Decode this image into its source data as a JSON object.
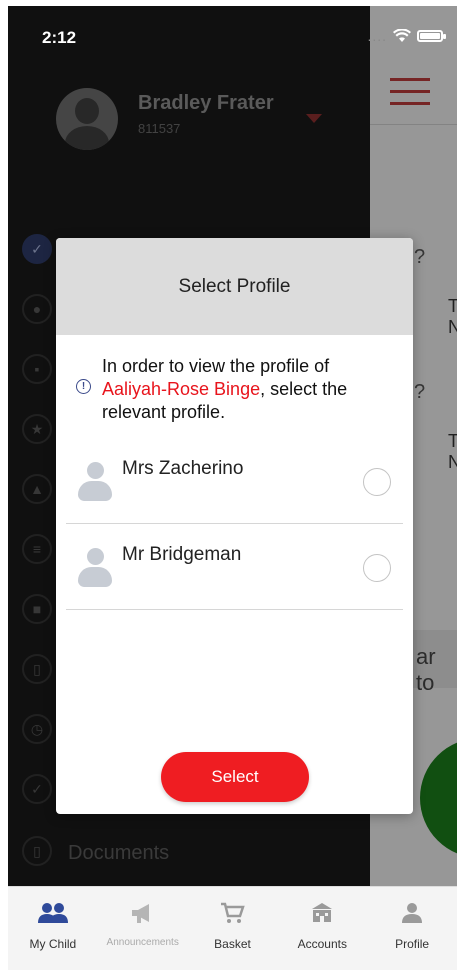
{
  "status_bar": {
    "time": "2:12"
  },
  "drawer": {
    "user_name": "Bradley Frater",
    "user_id": "811537",
    "documents_label": "Documents"
  },
  "background_page": {
    "banner_text": "ar to"
  },
  "modal": {
    "title": "Select Profile",
    "intro_prefix": "In order to view the profile of",
    "child_name": "Aaliyah-Rose Binge",
    "intro_suffix": ", select the relevant profile.",
    "profiles": [
      {
        "name": "Mrs Zacherino"
      },
      {
        "name": "Mr Bridgeman"
      }
    ],
    "select_label": "Select"
  },
  "tabbar": {
    "tabs": [
      {
        "label": "My Child",
        "icon": "people-icon"
      },
      {
        "label": "Announcements",
        "icon": "megaphone-icon"
      },
      {
        "label": "Basket",
        "icon": "cart-icon"
      },
      {
        "label": "Accounts",
        "icon": "building-icon"
      },
      {
        "label": "Profile",
        "icon": "person-icon"
      }
    ]
  },
  "colors": {
    "accent_red": "#ef1d22",
    "drawer_bg": "#1a1a1a",
    "active_blue": "#2d3a66"
  }
}
